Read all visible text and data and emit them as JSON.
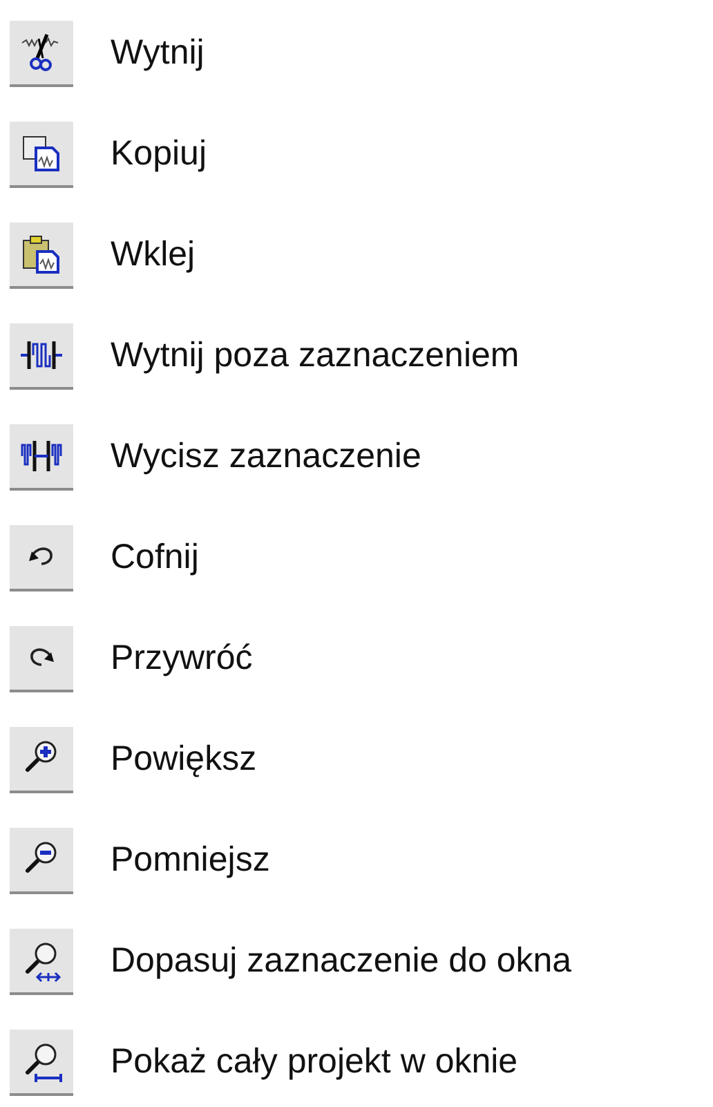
{
  "items": [
    {
      "kind": "cut",
      "label": "Wytnij"
    },
    {
      "kind": "copy",
      "label": "Kopiuj"
    },
    {
      "kind": "paste",
      "label": "Wklej"
    },
    {
      "kind": "trim",
      "label": "Wytnij poza zaznaczeniem"
    },
    {
      "kind": "silence",
      "label": "Wycisz zaznaczenie"
    },
    {
      "kind": "undo",
      "label": "Cofnij"
    },
    {
      "kind": "redo",
      "label": "Przywróć"
    },
    {
      "kind": "zoomin",
      "label": "Powiększ"
    },
    {
      "kind": "zoomout",
      "label": "Pomniejsz"
    },
    {
      "kind": "fitselection",
      "label": "Dopasuj zaznaczenie do okna"
    },
    {
      "kind": "fitproject",
      "label": "Pokaż cały projekt w oknie"
    }
  ]
}
